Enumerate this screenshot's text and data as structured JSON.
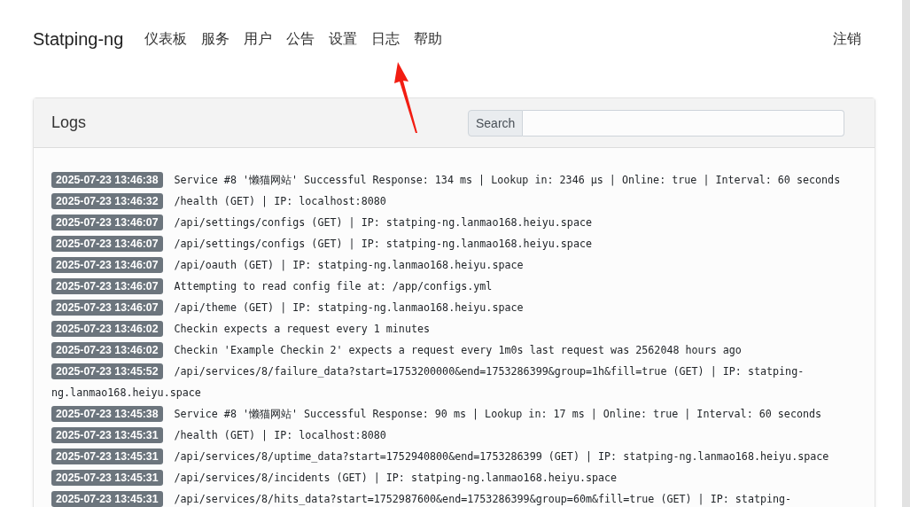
{
  "navbar": {
    "brand": "Statping-ng",
    "items": [
      "仪表板",
      "服务",
      "用户",
      "公告",
      "设置",
      "日志",
      "帮助"
    ],
    "logout": "注销"
  },
  "logs_card": {
    "title": "Logs",
    "search": {
      "button": "Search"
    },
    "entries": [
      {
        "time": "2025-07-23 13:46:38",
        "message": "Service #8 '懒猫网站' Successful Response: 134 ms | Lookup in: 2346 µs | Online: true | Interval: 60 seconds"
      },
      {
        "time": "2025-07-23 13:46:32",
        "message": "/health (GET) | IP: localhost:8080"
      },
      {
        "time": "2025-07-23 13:46:07",
        "message": "/api/settings/configs (GET) | IP: statping-ng.lanmao168.heiyu.space"
      },
      {
        "time": "2025-07-23 13:46:07",
        "message": "/api/settings/configs (GET) | IP: statping-ng.lanmao168.heiyu.space"
      },
      {
        "time": "2025-07-23 13:46:07",
        "message": "/api/oauth (GET) | IP: statping-ng.lanmao168.heiyu.space"
      },
      {
        "time": "2025-07-23 13:46:07",
        "message": "Attempting to read config file at: /app/configs.yml"
      },
      {
        "time": "2025-07-23 13:46:07",
        "message": "/api/theme (GET) | IP: statping-ng.lanmao168.heiyu.space"
      },
      {
        "time": "2025-07-23 13:46:02",
        "message": "Checkin expects a request every 1 minutes"
      },
      {
        "time": "2025-07-23 13:46:02",
        "message": "Checkin 'Example Checkin 2' expects a request every 1m0s last request was 2562048 hours ago"
      },
      {
        "time": "2025-07-23 13:45:52",
        "message": "/api/services/8/failure_data?start=1753200000&end=1753286399&group=1h&fill=true (GET) | IP: statping-",
        "continuation": "ng.lanmao168.heiyu.space"
      },
      {
        "time": "2025-07-23 13:45:38",
        "message": "Service #8 '懒猫网站' Successful Response: 90 ms | Lookup in: 17 ms | Online: true | Interval: 60 seconds"
      },
      {
        "time": "2025-07-23 13:45:31",
        "message": "/health (GET) | IP: localhost:8080"
      },
      {
        "time": "2025-07-23 13:45:31",
        "message": "/api/services/8/uptime_data?start=1752940800&end=1753286399 (GET) | IP: statping-ng.lanmao168.heiyu.space"
      },
      {
        "time": "2025-07-23 13:45:31",
        "message": "/api/services/8/incidents (GET) | IP: statping-ng.lanmao168.heiyu.space"
      },
      {
        "time": "2025-07-23 13:45:31",
        "message": "/api/services/8/hits_data?start=1752987600&end=1753286399&group=60m&fill=true (GET) | IP: statping-"
      }
    ]
  }
}
